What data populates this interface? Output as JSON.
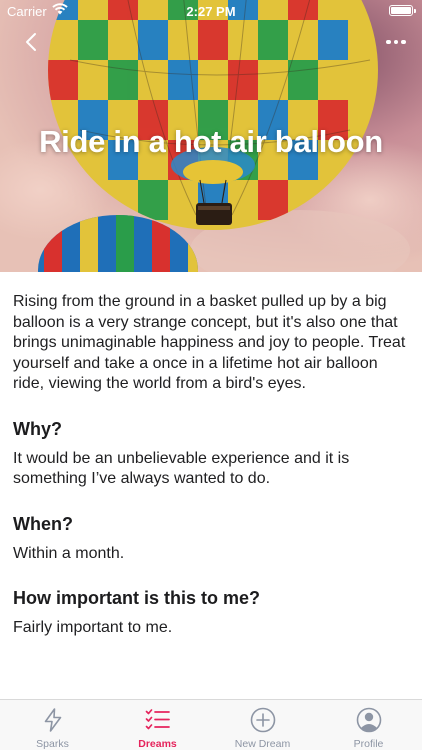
{
  "status_bar": {
    "carrier": "Carrier",
    "time": "2:27 PM"
  },
  "hero": {
    "title": "Ride in a hot air balloon",
    "back_icon": "chevron-left-icon",
    "more_icon": "more-horizontal-icon"
  },
  "content": {
    "description": "Rising from the ground in a basket pulled up by a big balloon is a very strange concept, but it's also one that brings unimaginable happiness and joy to people. Treat yourself and take a once in a lifetime hot air balloon ride, viewing the world from a bird's eyes.",
    "sections": [
      {
        "heading": "Why?",
        "body": "It would be an unbelievable experience and it is something I’ve always wanted to do."
      },
      {
        "heading": "When?",
        "body": "Within a month."
      },
      {
        "heading": "How important is this to me?",
        "body": "Fairly important to me."
      }
    ]
  },
  "tab_bar": {
    "active_color": "#e5245c",
    "inactive_color": "#8d95a4",
    "tabs": [
      {
        "label": "Sparks",
        "icon": "lightning-icon",
        "active": false
      },
      {
        "label": "Dreams",
        "icon": "checklist-icon",
        "active": true
      },
      {
        "label": "New Dream",
        "icon": "plus-circle-icon",
        "active": false
      },
      {
        "label": "Profile",
        "icon": "user-circle-icon",
        "active": false
      }
    ]
  }
}
